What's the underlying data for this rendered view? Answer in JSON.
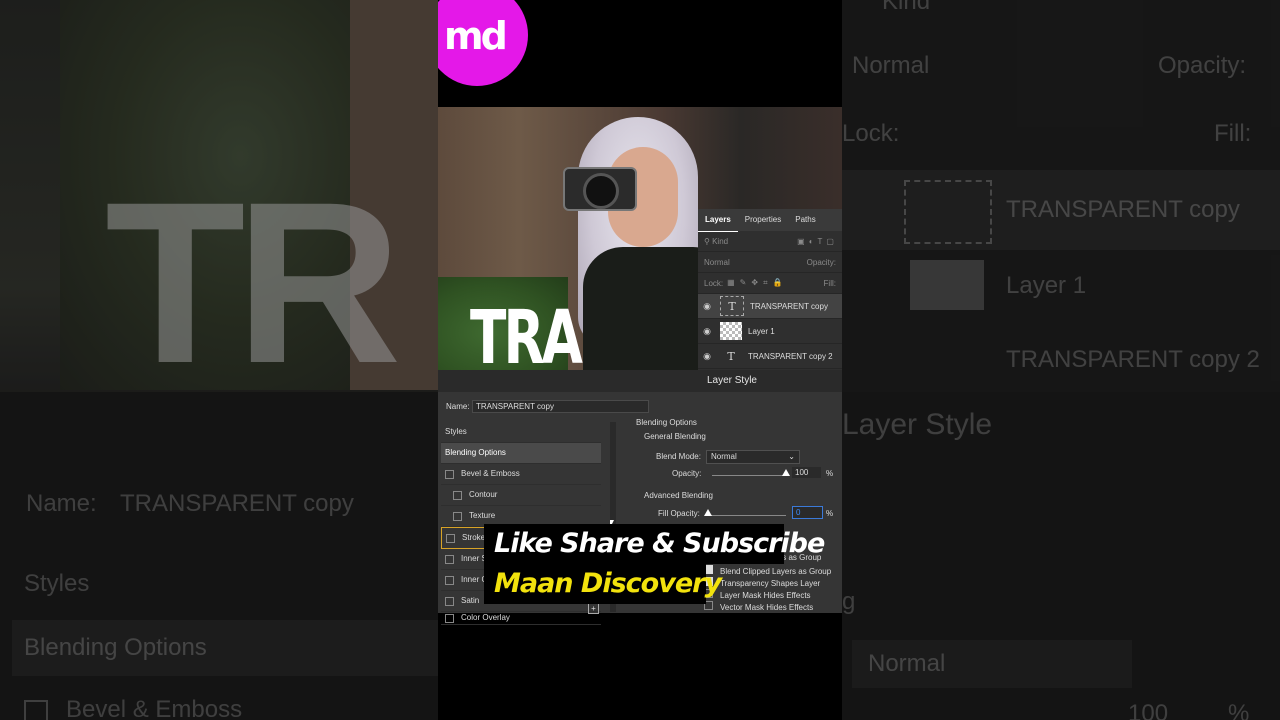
{
  "logo": {
    "text": "md",
    "color": "#e418e8"
  },
  "photo": {
    "overlay_text": "TRA"
  },
  "layers_panel": {
    "tabs": [
      "Layers",
      "Properties",
      "Paths"
    ],
    "search_placeholder": "Kind",
    "blend_mode": "Normal",
    "opacity_label": "Opacity:",
    "lock_label": "Lock:",
    "fill_label": "Fill:",
    "layers": [
      {
        "name": "TRANSPARENT copy",
        "type": "text",
        "selected": true
      },
      {
        "name": "Layer 1",
        "type": "image",
        "selected": false
      },
      {
        "name": "TRANSPARENT copy 2",
        "type": "text",
        "selected": false
      }
    ]
  },
  "layer_style": {
    "title": "Layer Style",
    "name_label": "Name:",
    "name_value": "TRANSPARENT copy",
    "styles": [
      "Styles",
      "Blending Options",
      "Bevel & Emboss",
      "Contour",
      "Texture",
      "Stroke",
      "Inner S",
      "Inner G",
      "Satin",
      "Color Overlay"
    ],
    "blending_options": "Blending Options",
    "general_blending": "General Blending",
    "blend_mode_label": "Blend Mode:",
    "blend_mode_value": "Normal",
    "opacity_label": "Opacity:",
    "opacity_value": "100",
    "percent": "%",
    "advanced_blending": "Advanced Blending",
    "fill_opacity_label": "Fill Opacity:",
    "fill_opacity_value": "0",
    "checkbox_options": [
      "cts as Group",
      "Blend Clipped Layers as Group",
      "Transparency Shapes Layer",
      "Layer Mask Hides Effects",
      "Vector Mask Hides Effects"
    ]
  },
  "caption": {
    "line1": "Like Share & Subscribe",
    "line2": "Maan Discovery",
    "line2_color": "#f2e20d"
  },
  "backdrop": {
    "left_big": "TR",
    "left_name_label": "Name:",
    "left_name_value": "TRANSPARENT copy",
    "left_styles": "Styles",
    "left_blending": "Blending Options",
    "left_bevel": "Bevel & Emboss",
    "right_kind": "Kind",
    "right_normal": "Normal",
    "right_opacity": "Opacity:",
    "right_lock": "Lock:",
    "right_fill": "Fill:",
    "right_layer1": "TRANSPARENT copy",
    "right_layer2": "Layer 1",
    "right_layer3": "TRANSPARENT copy 2",
    "right_layer_style": "Layer Style",
    "right_g": "g",
    "right_normal2": "Normal",
    "right_100": "100",
    "right_pct": "%"
  }
}
